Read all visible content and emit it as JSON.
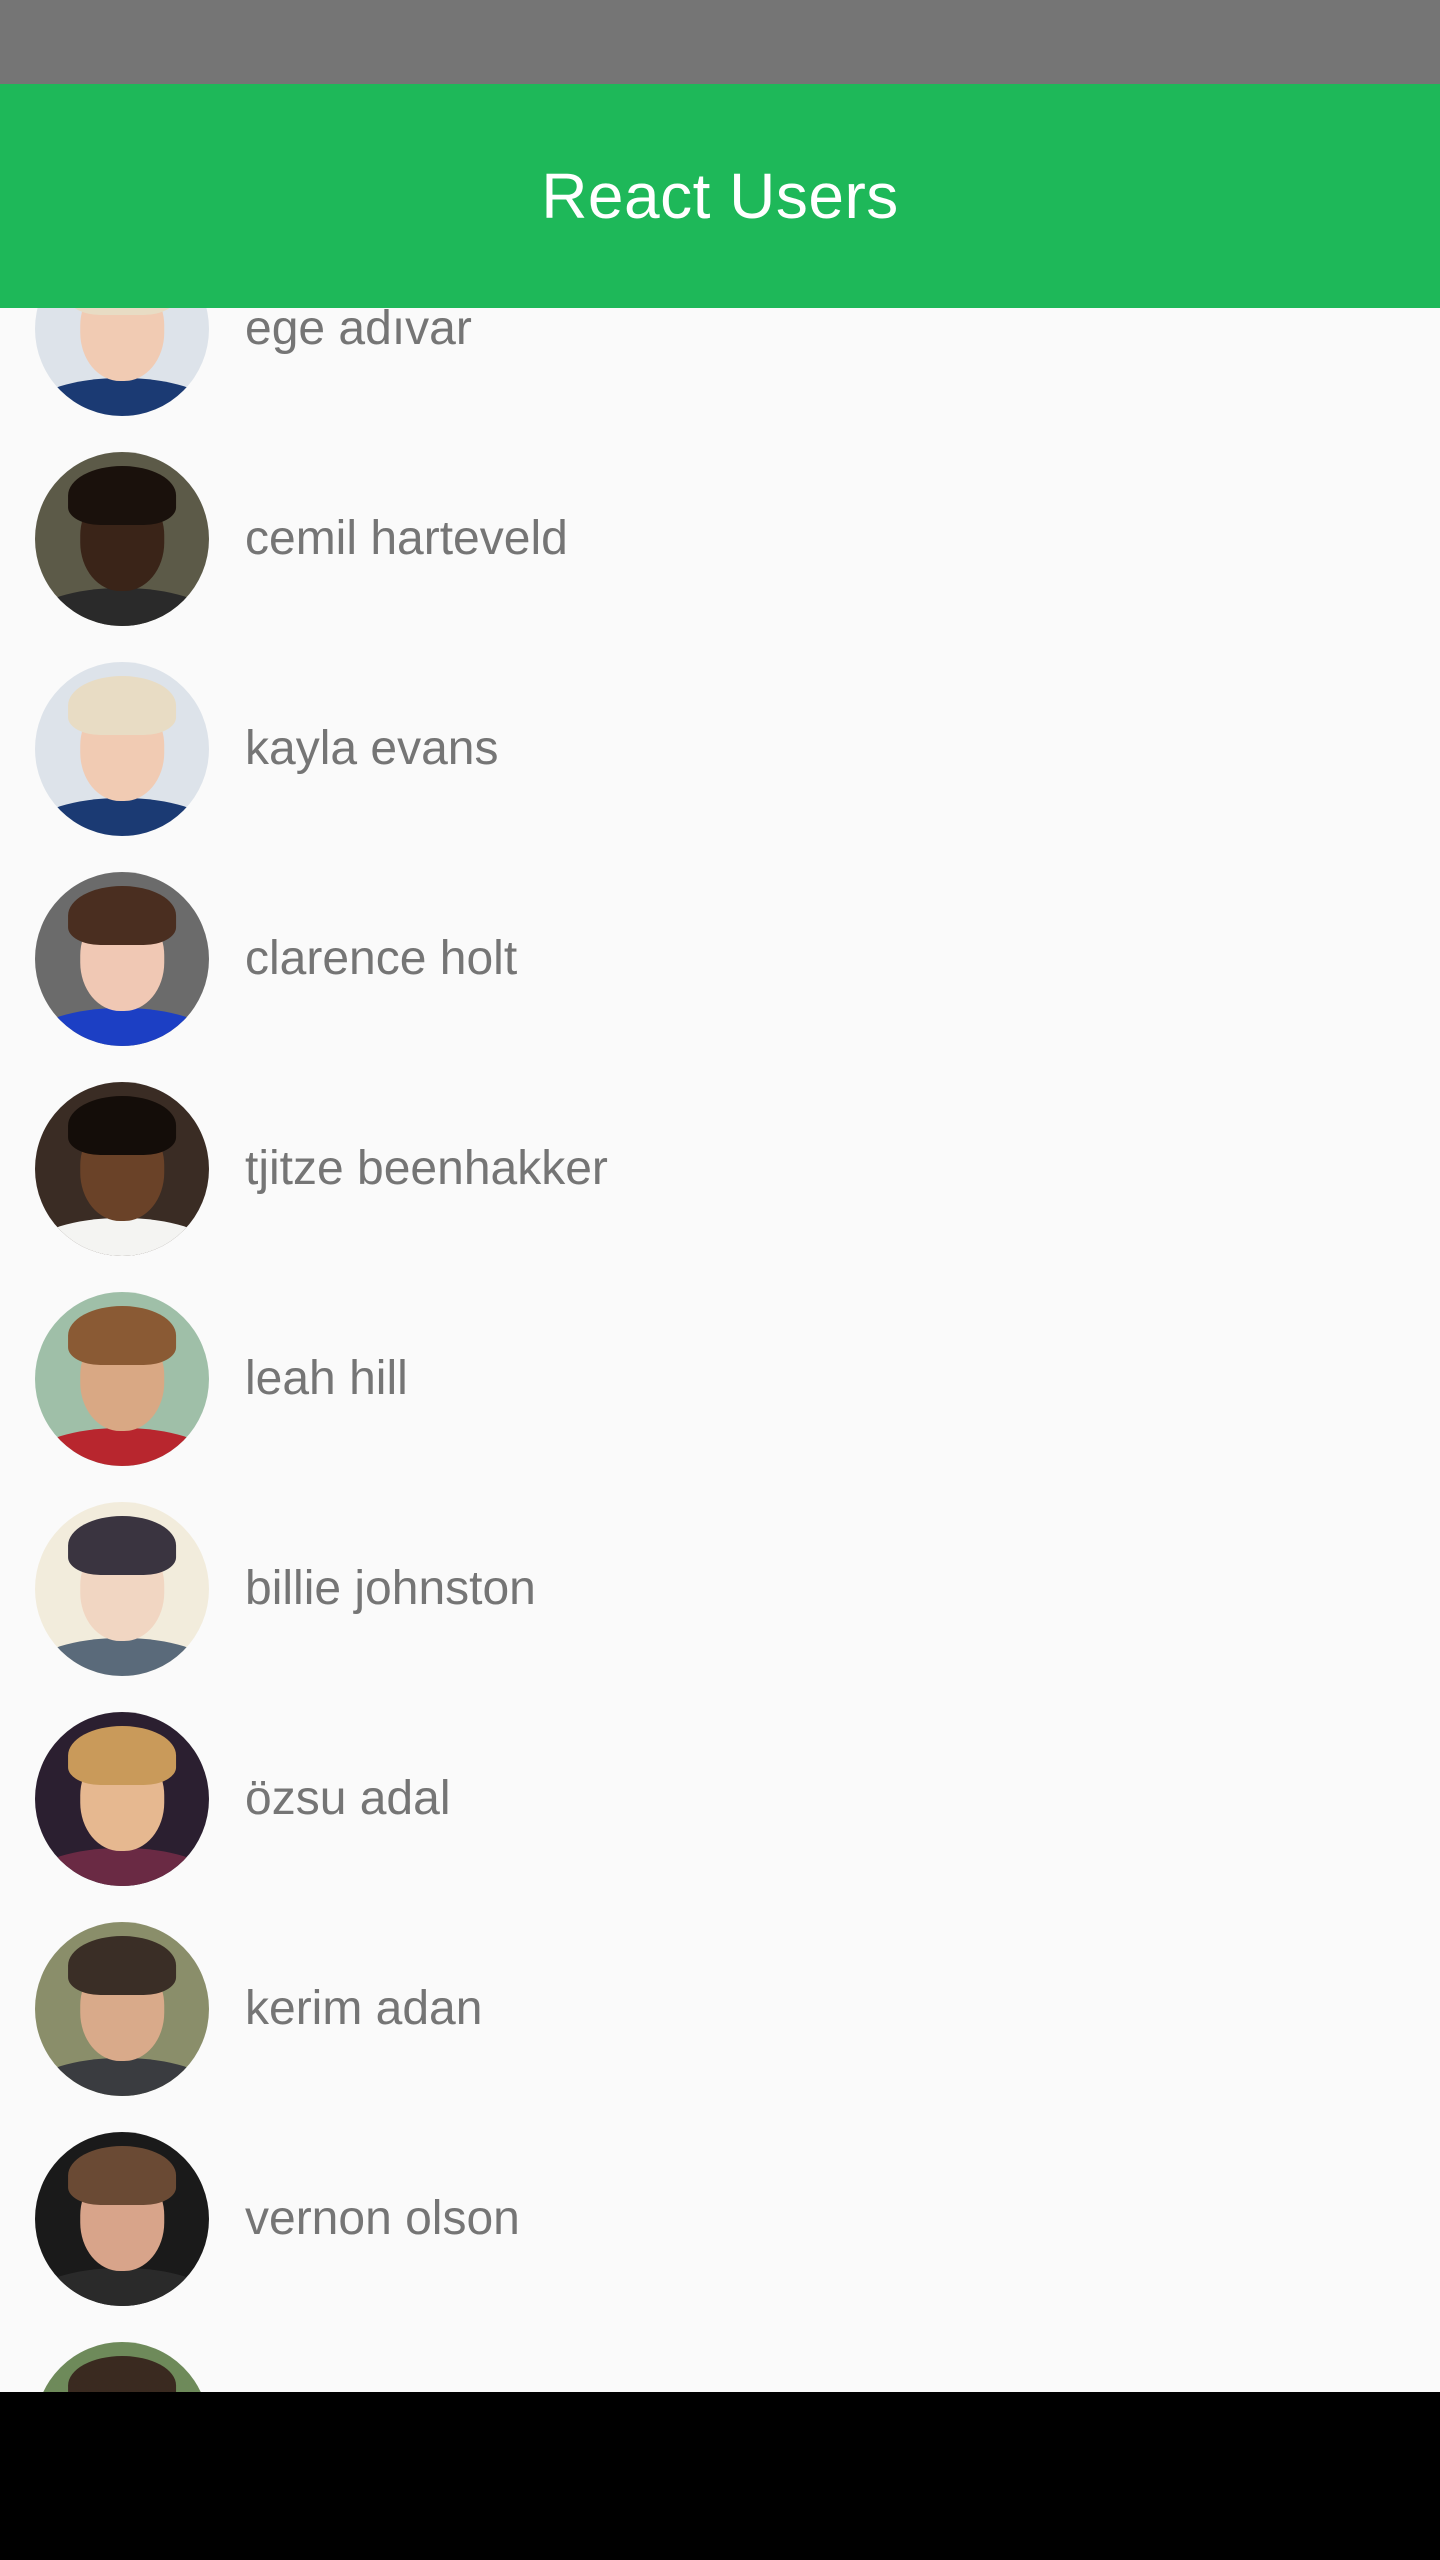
{
  "app_bar": {
    "title": "React Users",
    "color": "#1eb859"
  },
  "users": [
    {
      "name": "ege adıvar",
      "avatar": {
        "bg": "#dde3ea",
        "skin": "#f1cbb3",
        "hair": "#e8dcc4",
        "shirt": "#1b3a73"
      }
    },
    {
      "name": "cemil harteveld",
      "avatar": {
        "bg": "#5c5a48",
        "skin": "#3a2418",
        "hair": "#1a110c",
        "shirt": "#2a2a2a"
      }
    },
    {
      "name": "kayla evans",
      "avatar": {
        "bg": "#dde3ea",
        "skin": "#f1cbb3",
        "hair": "#e8dcc4",
        "shirt": "#1b3a73"
      }
    },
    {
      "name": "clarence holt",
      "avatar": {
        "bg": "#6b6b6b",
        "skin": "#f0c8b4",
        "hair": "#4a2e20",
        "shirt": "#1c3fc4"
      }
    },
    {
      "name": "tjitze beenhakker",
      "avatar": {
        "bg": "#3a2c24",
        "skin": "#6a4228",
        "hair": "#140d09",
        "shirt": "#f4f4f2"
      }
    },
    {
      "name": "leah hill",
      "avatar": {
        "bg": "#9fbfa8",
        "skin": "#d9a884",
        "hair": "#8a5a34",
        "shirt": "#b8262e"
      }
    },
    {
      "name": "billie johnston",
      "avatar": {
        "bg": "#f2ecdc",
        "skin": "#f1d6c2",
        "hair": "#3a3440",
        "shirt": "#5a6a7a"
      }
    },
    {
      "name": "özsu adal",
      "avatar": {
        "bg": "#2b1f30",
        "skin": "#e6b890",
        "hair": "#c99a5a",
        "shirt": "#6a2a44"
      }
    },
    {
      "name": "kerim adan",
      "avatar": {
        "bg": "#8a8e6a",
        "skin": "#d9aa8a",
        "hair": "#3a2e26",
        "shirt": "#3a3c40"
      }
    },
    {
      "name": "vernon olson",
      "avatar": {
        "bg": "#1a1a1a",
        "skin": "#d8a48a",
        "hair": "#6a4a34",
        "shirt": "#2a2a2a"
      }
    },
    {
      "name": "",
      "avatar": {
        "bg": "#6e8a5a",
        "skin": "#e2b898",
        "hair": "#3a2a20",
        "shirt": "#3a3a3a"
      }
    }
  ]
}
